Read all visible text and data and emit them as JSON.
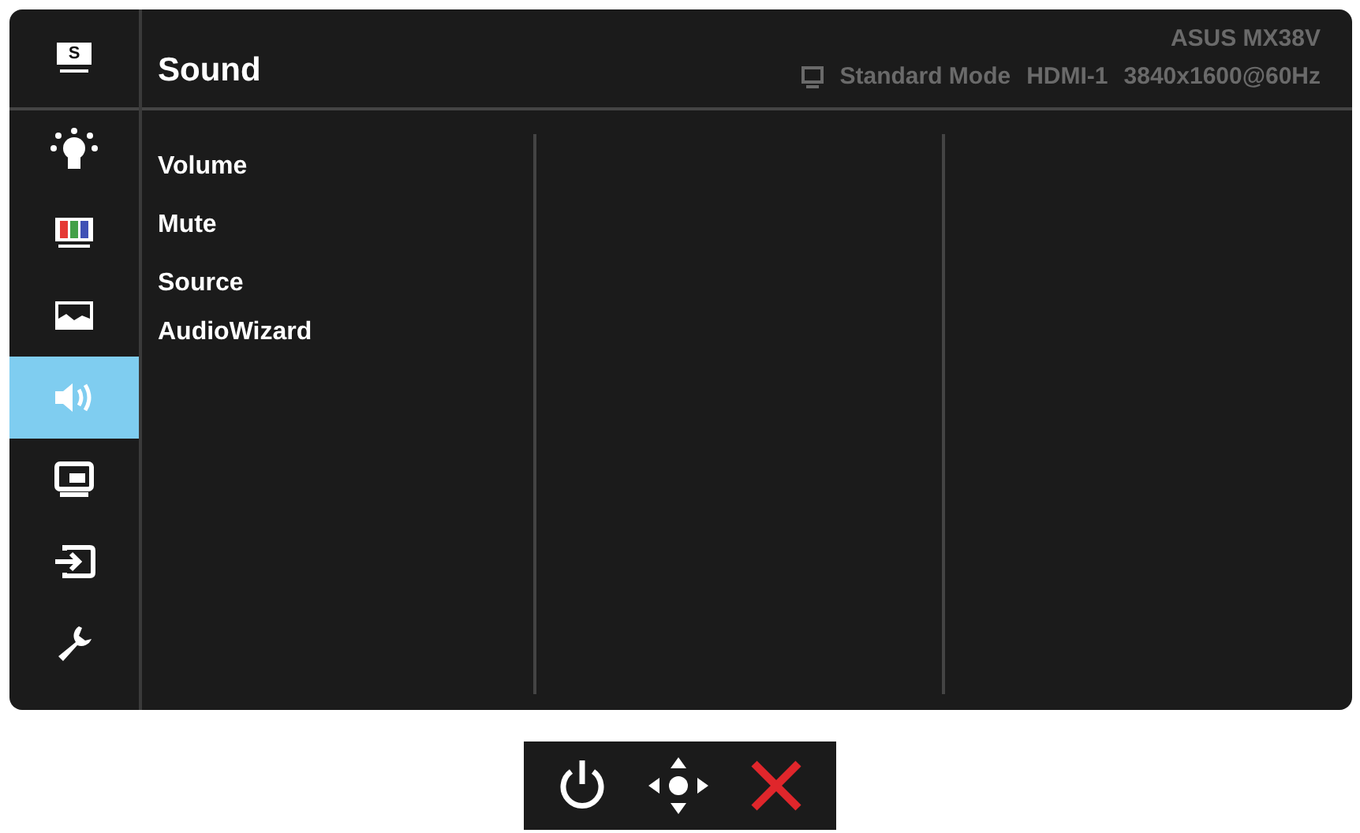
{
  "header": {
    "title": "Sound",
    "model": "ASUS  MX38V",
    "mode": "Standard Mode",
    "input": "HDMI-1",
    "resolution": "3840x1600@60Hz"
  },
  "sidebar": {
    "items": [
      {
        "kind": "splendid",
        "badge": "S",
        "selected": false
      },
      {
        "kind": "bulb",
        "selected": false
      },
      {
        "kind": "color",
        "selected": false
      },
      {
        "kind": "image",
        "selected": false
      },
      {
        "kind": "sound",
        "selected": true
      },
      {
        "kind": "pip",
        "selected": false
      },
      {
        "kind": "input",
        "selected": false
      },
      {
        "kind": "wrench",
        "selected": false
      }
    ]
  },
  "menu": {
    "items": [
      {
        "label": "Volume"
      },
      {
        "label": "Mute"
      },
      {
        "label": "Source"
      },
      {
        "label": "AudioWizard"
      }
    ]
  },
  "keys": [
    {
      "kind": "power"
    },
    {
      "kind": "joystick"
    },
    {
      "kind": "close"
    }
  ]
}
